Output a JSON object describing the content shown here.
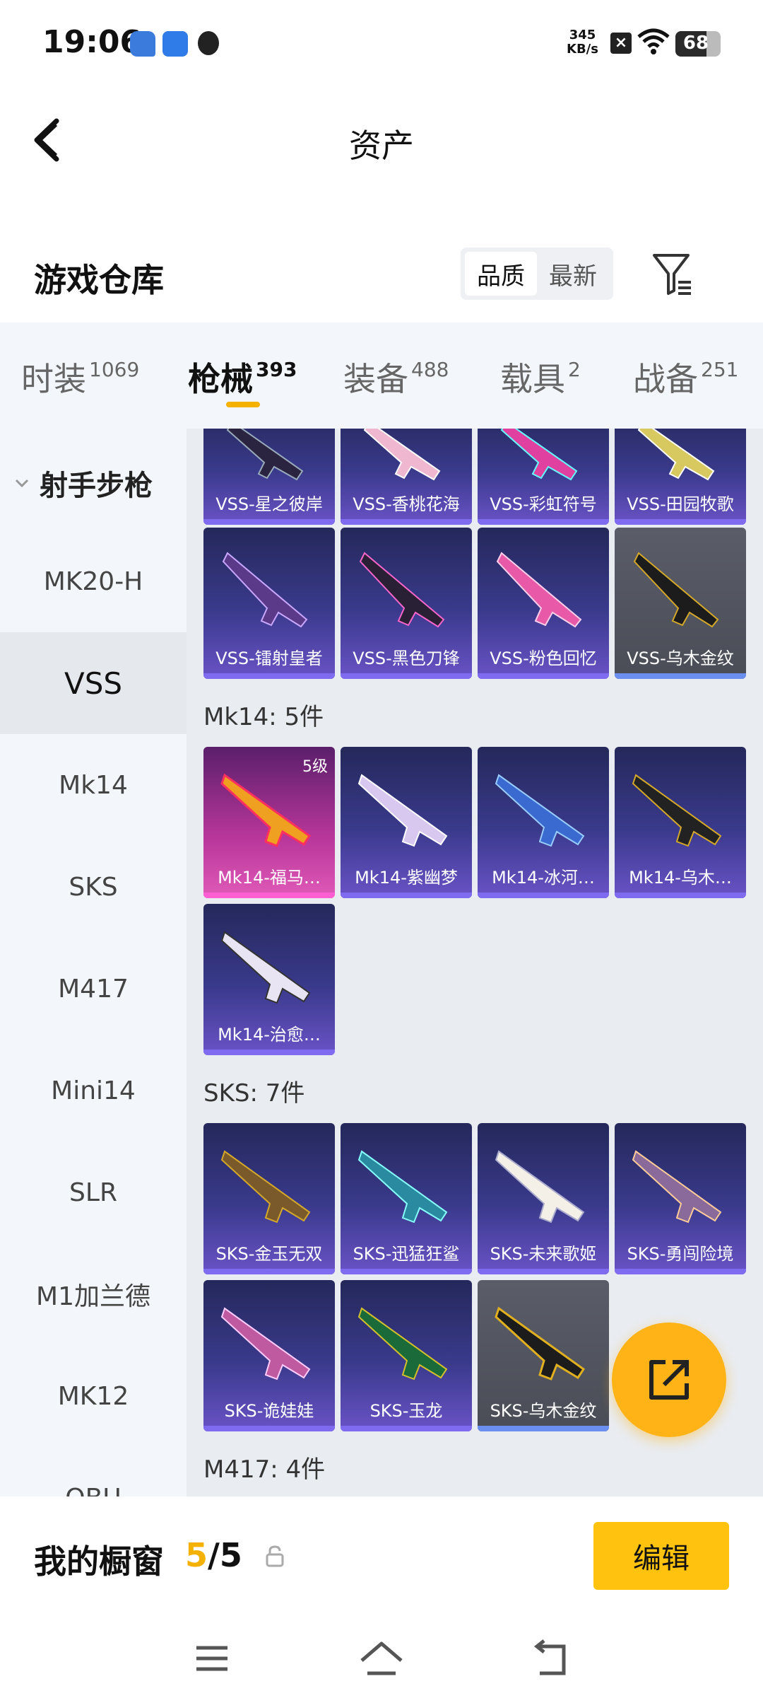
{
  "status_bar": {
    "time": "19:06",
    "speed_value": "345",
    "speed_unit": "KB/s",
    "battery": "68",
    "battery_level": 0.68
  },
  "header": {
    "title": "资产"
  },
  "warehouse": {
    "title": "游戏仓库",
    "sort_options": [
      "品质",
      "最新"
    ],
    "sort_selected": "品质"
  },
  "tabs": [
    {
      "label": "时装",
      "count": "1069"
    },
    {
      "label": "枪械",
      "count": "393"
    },
    {
      "label": "装备",
      "count": "488"
    },
    {
      "label": "载具",
      "count": "2"
    },
    {
      "label": "战备",
      "count": "251"
    }
  ],
  "sidebar": {
    "group": "射手步枪",
    "items": [
      "MK20-H",
      "VSS",
      "Mk14",
      "SKS",
      "M417",
      "Mini14",
      "SLR",
      "M1加兰德",
      "MK12",
      "QBU"
    ],
    "active": "VSS"
  },
  "vss": {
    "row1": [
      "VSS-星之彼岸",
      "VSS-香桃花海",
      "VSS-彩虹符号",
      "VSS-田园牧歌"
    ],
    "row2": [
      "VSS-镭射皇者",
      "VSS-黑色刀锋",
      "VSS-粉色回忆",
      "VSS-乌木金纹"
    ]
  },
  "mk14": {
    "title": "Mk14: 5件",
    "items": [
      "Mk14-福马…",
      "Mk14-紫幽梦",
      "Mk14-冰河…",
      "Mk14-乌木…",
      "Mk14-治愈…"
    ],
    "badge": "5级"
  },
  "sks": {
    "title": "SKS: 7件",
    "items": [
      "SKS-金玉无双",
      "SKS-迅猛狂鲨",
      "SKS-未来歌姬",
      "SKS-勇闯险境",
      "SKS-诡娃娃",
      "SKS-玉龙",
      "SKS-乌木金纹"
    ]
  },
  "m417": {
    "title": "M417: 4件"
  },
  "showcase": {
    "label": "我的橱窗",
    "current": "5",
    "total": "/5",
    "edit_label": "编辑"
  },
  "colors": {
    "accent": "#f5b100",
    "card_purple": "#3a3a8c",
    "card_bar": "#7e6bf0",
    "highlight_pink": "#ff5fd2"
  }
}
